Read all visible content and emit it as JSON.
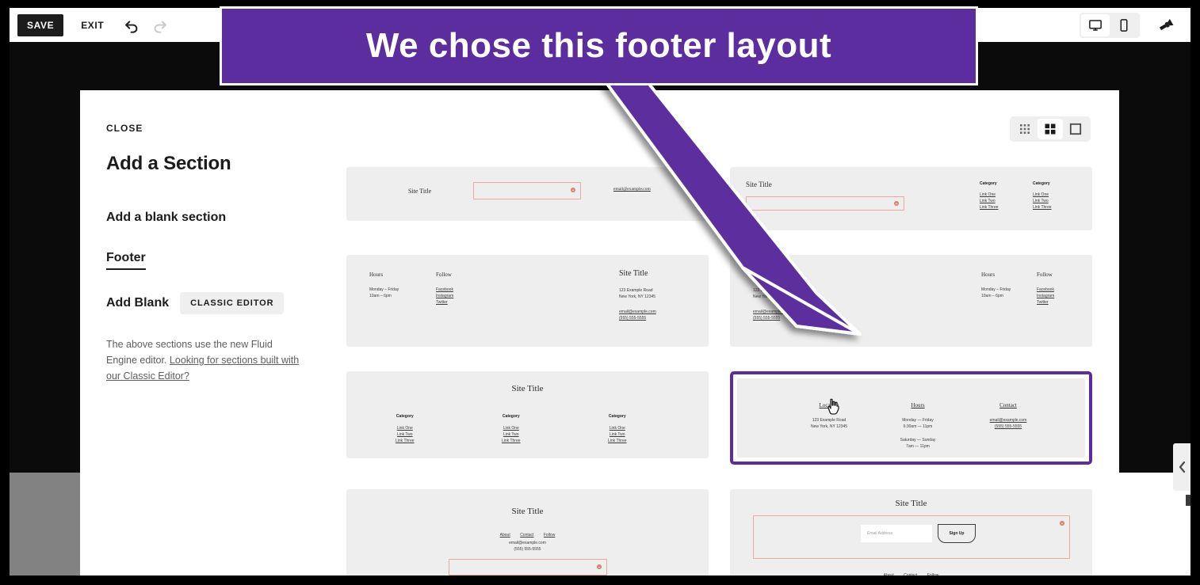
{
  "topbar": {
    "save_label": "SAVE",
    "exit_label": "EXIT",
    "undo_icon": "undo-arrow-icon",
    "redo_icon": "redo-arrow-icon",
    "desktop_icon": "desktop-monitor-icon",
    "mobile_icon": "mobile-phone-icon",
    "brush_icon": "paintbrush-icon"
  },
  "callout": {
    "text": "We chose this footer layout",
    "background": "#5b2d9e",
    "text_color": "#ffffff",
    "arrow_color": "#5b2d9e"
  },
  "panel": {
    "close_label": "CLOSE",
    "title": "Add a Section",
    "blank_section_label": "Add a blank section",
    "footer_tab_label": "Footer",
    "add_blank_label": "Add Blank",
    "classic_editor_label": "CLASSIC EDITOR",
    "note_prefix": "The above sections use the new Fluid Engine editor. ",
    "note_link": "Looking for sections built with our Classic Editor?"
  },
  "view_modes": [
    {
      "name": "list-view",
      "icon": "dot-grid-icon",
      "active": false
    },
    {
      "name": "grid-view",
      "icon": "four-square-grid-icon",
      "active": true
    },
    {
      "name": "large-view",
      "icon": "single-square-icon",
      "active": true
    }
  ],
  "shared": {
    "site_title": "Site Title",
    "email": "email@example.com",
    "phone": "(555) 555-5555",
    "address_line1": "123 Example Road",
    "address_line2": "New York, NY 12345",
    "category": "Category",
    "links": [
      "Link One",
      "Link Two",
      "Link Three"
    ],
    "hours_heading": "Hours",
    "follow_heading": "Follow",
    "location_heading": "Location",
    "contact_heading": "Contact",
    "social": [
      "Facebook",
      "Instagram",
      "Twitter"
    ],
    "weekday_label": "Monday – Friday",
    "weekday_hours": "10am – 6pm",
    "nav_links": [
      "About",
      "Contact",
      "Follow"
    ],
    "email_placeholder": "Email Address",
    "signup_label": "Sign Up",
    "sel_weekday_label": "Monday — Friday",
    "sel_weekday_hours": "6:30am — 11pm",
    "sel_weekend_label": "Saturday — Sunday",
    "sel_weekend_hours": "7am — 11pm"
  },
  "thumbnails": [
    {
      "name": "footer-layout-1",
      "selected": false
    },
    {
      "name": "footer-layout-2",
      "selected": false
    },
    {
      "name": "footer-layout-3",
      "selected": false
    },
    {
      "name": "footer-layout-4",
      "selected": false
    },
    {
      "name": "footer-layout-5",
      "selected": false
    },
    {
      "name": "footer-layout-6",
      "selected": true
    },
    {
      "name": "footer-layout-7",
      "selected": false
    },
    {
      "name": "footer-layout-8",
      "selected": false
    }
  ],
  "drawer": {
    "icon": "chevron-left-icon"
  },
  "cursor": {
    "icon": "pointer-hand-cursor"
  }
}
